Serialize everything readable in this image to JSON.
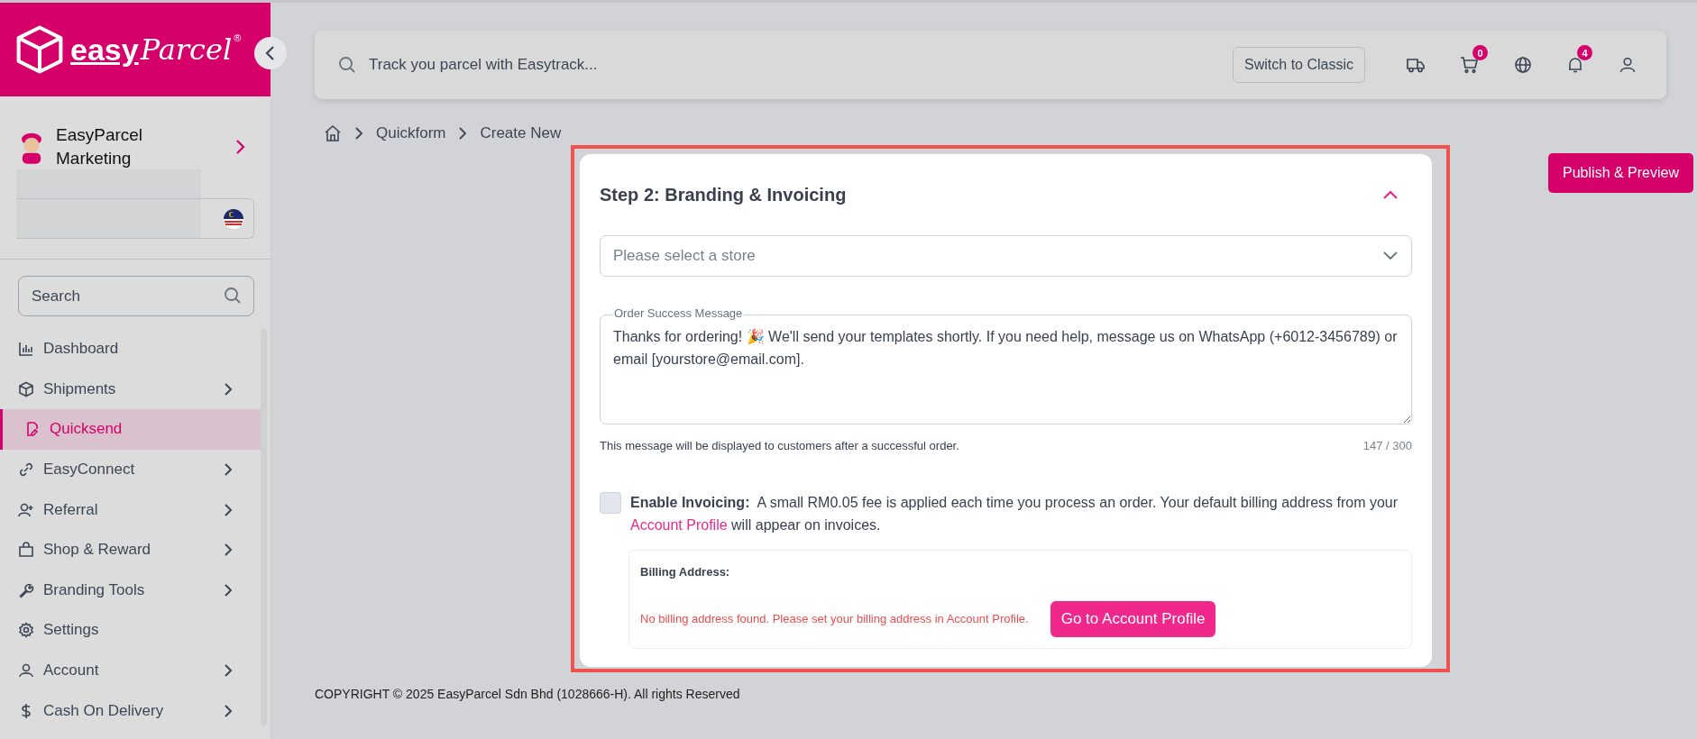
{
  "logo": {
    "word1": "easy",
    "word2": "Parcel",
    "mark": "®"
  },
  "profile": {
    "name": "EasyParcel Marketing"
  },
  "search": {
    "placeholder": "Search"
  },
  "sidebar": {
    "items": [
      {
        "label": "Dashboard",
        "has_submenu": false,
        "selected": false
      },
      {
        "label": "Shipments",
        "has_submenu": true,
        "selected": false
      },
      {
        "label": "Quicksend",
        "has_submenu": false,
        "selected": true
      },
      {
        "label": "EasyConnect",
        "has_submenu": true,
        "selected": false
      },
      {
        "label": "Referral",
        "has_submenu": true,
        "selected": false
      },
      {
        "label": "Shop & Reward",
        "has_submenu": true,
        "selected": false
      },
      {
        "label": "Branding Tools",
        "has_submenu": true,
        "selected": false
      },
      {
        "label": "Settings",
        "has_submenu": false,
        "selected": false
      },
      {
        "label": "Account",
        "has_submenu": true,
        "selected": false
      },
      {
        "label": "Cash On Delivery",
        "has_submenu": true,
        "selected": false
      }
    ]
  },
  "topbar": {
    "track_placeholder": "Track you parcel with Easytrack...",
    "switch_button": "Switch to Classic",
    "cart_count": "0",
    "notification_count": "4"
  },
  "breadcrumb": [
    "Quickform",
    "Create New"
  ],
  "publish_button": "Publish & Preview",
  "card": {
    "title": "Step 2: Branding & Invoicing",
    "expanded": true,
    "store_select": {
      "placeholder": "Please select a store"
    },
    "message": {
      "label": "Order Success Message",
      "value": "Thanks for ordering! 🎉 We'll send your templates shortly. If you need help, message us on WhatsApp (+6012-3456789) or email [yourstore@email.com].",
      "hint": "This message will be displayed to customers after a successful order.",
      "counter": "147 / 300"
    },
    "invoicing": {
      "checked": false,
      "label": "Enable Invoicing:",
      "text": "A small RM0.05 fee is applied each time you process an order. Your default billing address from your",
      "link": "Account Profile",
      "text_after": "will appear on invoices."
    },
    "billing": {
      "title": "Billing Address:",
      "error": "No billing address found. Please set your billing address in Account Profile.",
      "button": "Go to Account Profile"
    }
  },
  "footer": "COPYRIGHT © 2025 EasyParcel Sdn Bhd (1028666-H). All rights Reserved"
}
